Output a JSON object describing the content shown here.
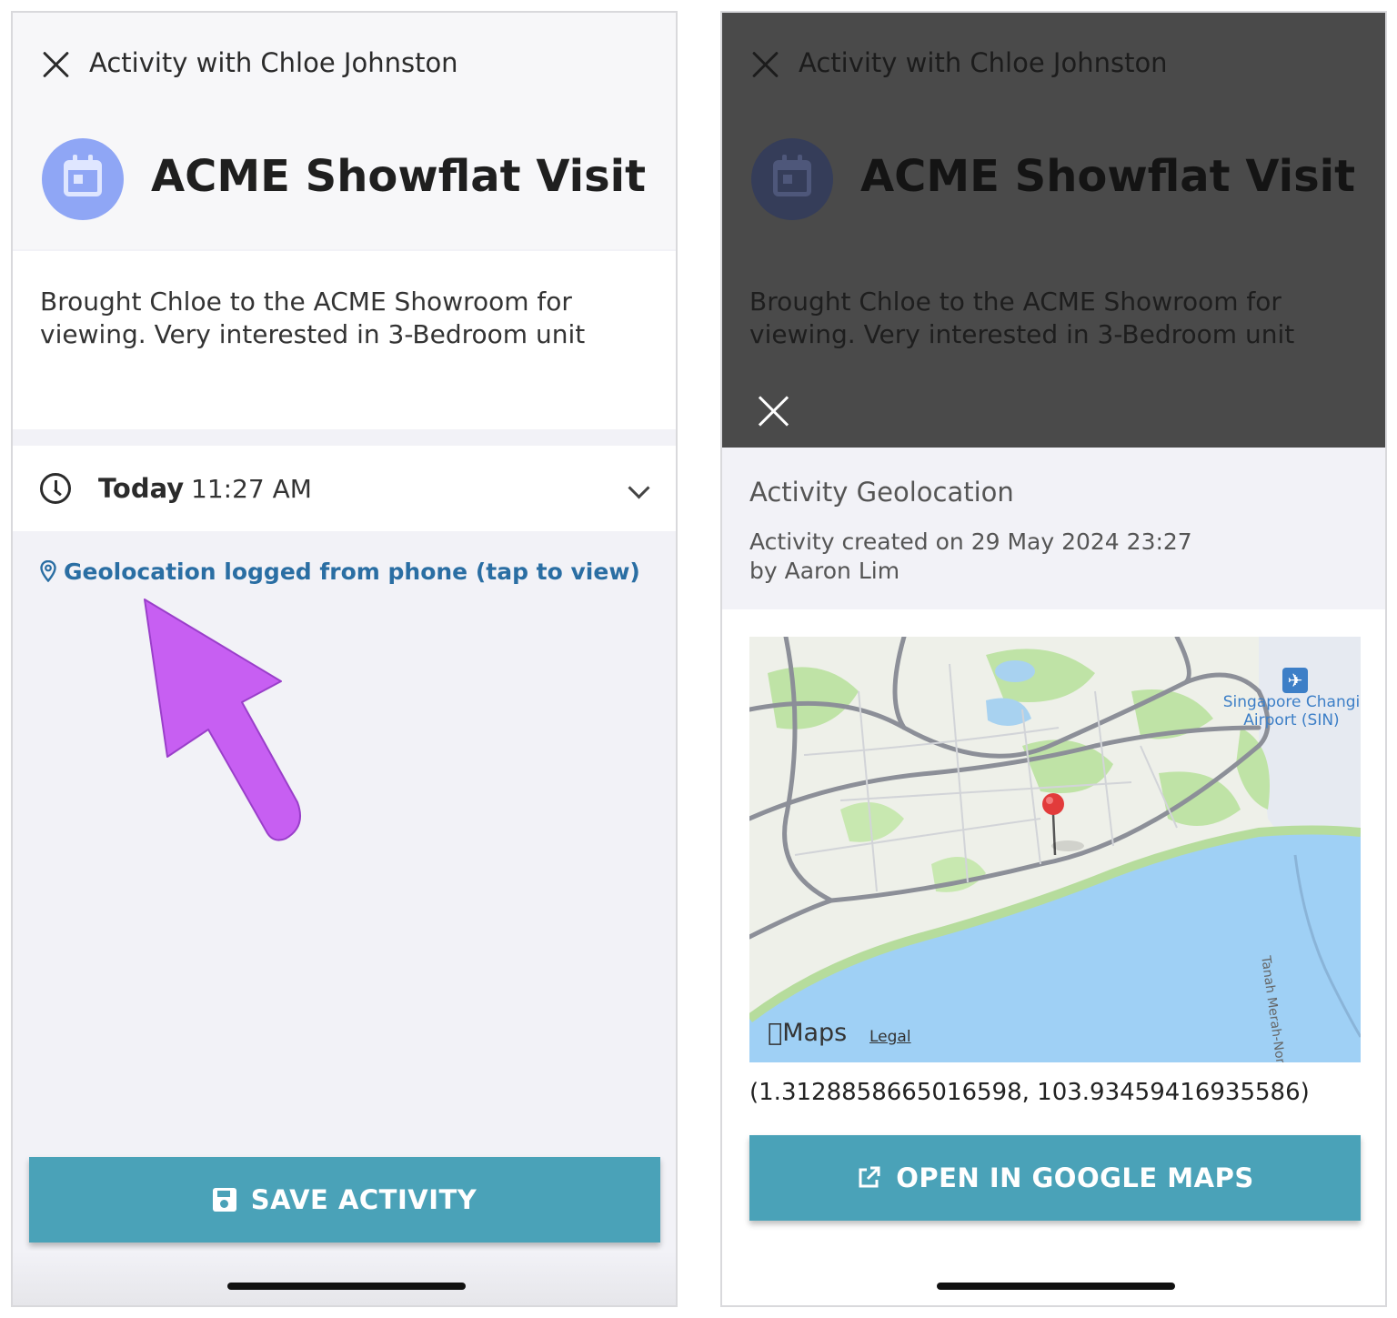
{
  "left": {
    "nav_title": "Activity with Chloe Johnston",
    "activity_title": "ACME Showflat Visit",
    "notes": "Brought Chloe to the ACME Showroom for viewing. Very interested in 3-Bedroom unit",
    "time_day": "Today",
    "time_value": "11:27 AM",
    "geo_link": "Geolocation logged from phone (tap to view)",
    "save_label": "SAVE ACTIVITY"
  },
  "right": {
    "nav_title": "Activity with Chloe Johnston",
    "activity_title": "ACME Showflat Visit",
    "notes": "Brought Chloe to the ACME Showroom for viewing. Very interested in 3-Bedroom unit",
    "sheet_title": "Activity Geolocation",
    "created_line": "Activity created on 29 May 2024 23:27",
    "by_line": "by Aaron Lim",
    "map": {
      "brand": "Maps",
      "legal": "Legal",
      "airport_line1": "Singapore Changi",
      "airport_line2": "Airport (SIN)",
      "road_label": "Tanah Merah-Nongsapura"
    },
    "coordinates": "(1.3128858665016598, 103.93459416935586)",
    "open_label": "OPEN IN GOOGLE MAPS"
  },
  "colors": {
    "accent": "#4aa2b8",
    "link": "#2a6ea3",
    "avatar": "#8fa6f5",
    "arrow": "#c75ff2",
    "pin": "#e23b3b"
  },
  "icons": [
    "close-icon",
    "calendar-icon",
    "clock-icon",
    "chevron-down-icon",
    "map-pin-icon",
    "floppy-disk-icon",
    "external-link-icon",
    "airplane-icon"
  ]
}
